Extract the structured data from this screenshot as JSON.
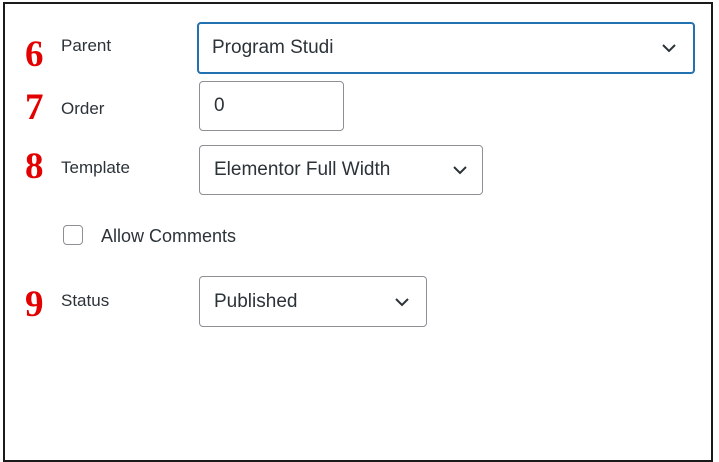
{
  "markers": {
    "parent": "6",
    "order": "7",
    "template": "8",
    "status": "9"
  },
  "fields": {
    "parent": {
      "label": "Parent",
      "value": "Program Studi"
    },
    "order": {
      "label": "Order",
      "value": "0"
    },
    "template": {
      "label": "Template",
      "value": "Elementor Full Width"
    },
    "comments": {
      "label": "Allow Comments",
      "checked": false
    },
    "status": {
      "label": "Status",
      "value": "Published"
    }
  },
  "colors": {
    "marker": "#e30000",
    "focus_border": "#2271b1",
    "field_border": "#8c8f94"
  },
  "icons": {
    "dropdown": "chevron-down-icon"
  }
}
